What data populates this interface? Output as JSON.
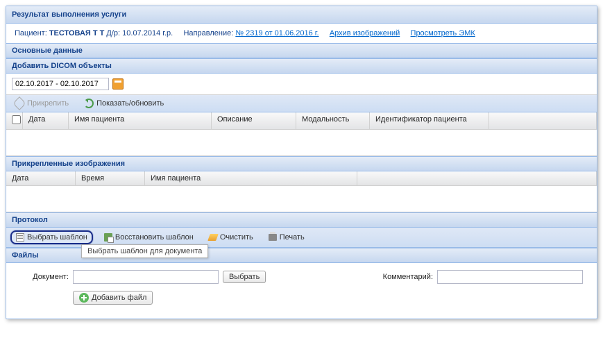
{
  "header": {
    "title": "Результат выполнения услуги"
  },
  "patient": {
    "label": "Пациент:",
    "name": "ТЕСТОВАЯ Т Т",
    "dob_label": "Д/р:",
    "dob": "10.07.2014",
    "dob_suffix": "г.р.",
    "direction_label": "Направление:",
    "direction_link": "№ 2319  от 01.06.2016   г.",
    "archive_link": "Архив изображений",
    "emk_link": "Просмотреть ЭМК"
  },
  "sections": {
    "main_data": "Основные данные",
    "add_dicom": "Добавить DICOM объекты",
    "attached_images": "Прикрепленные изображения",
    "protocol": "Протокол",
    "files": "Файлы"
  },
  "date_range": "02.10.2017 - 02.10.2017",
  "toolbar1": {
    "attach": "Прикрепить",
    "refresh": "Показать/обновить"
  },
  "grid1": {
    "cols": [
      "Дата",
      "Имя пациента",
      "Описание",
      "Модальность",
      "Идентификатор пациента"
    ]
  },
  "grid2": {
    "cols": [
      "Дата",
      "Время",
      "Имя пациента"
    ]
  },
  "toolbar2": {
    "choose_template": "Выбрать шаблон",
    "restore_template": "Восстановить шаблон",
    "clear": "Очистить",
    "print": "Печать"
  },
  "tooltip": "Выбрать шаблон для документа",
  "files_form": {
    "document_label": "Документ:",
    "choose_btn": "Выбрать",
    "comment_label": "Комментарий:",
    "add_file_btn": "Добавить файл"
  }
}
